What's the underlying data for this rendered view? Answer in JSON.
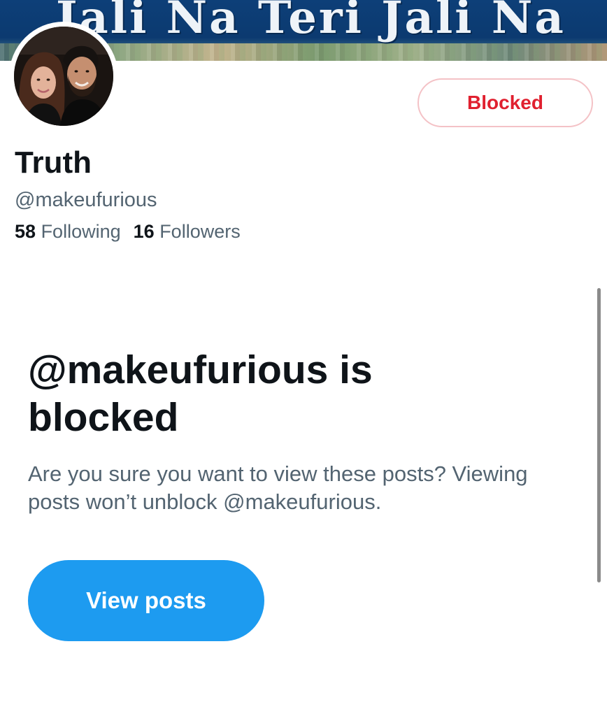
{
  "header": {
    "banner_text": "Jali Na Teri Jali Na"
  },
  "profile": {
    "display_name": "Truth",
    "handle": "@makeufurious",
    "following_count": "58",
    "following_label": "Following",
    "followers_count": "16",
    "followers_label": "Followers",
    "blocked_button_label": "Blocked"
  },
  "blocked_notice": {
    "title": "@makeufurious is blocked",
    "description": "Are you sure you want to view these posts? Viewing posts won’t unblock @makeufurious.",
    "view_posts_label": "View posts"
  },
  "colors": {
    "accent": "#1d9bf0",
    "blocked_red": "#e0202f",
    "secondary_text": "#536471",
    "primary_text": "#0f1419"
  }
}
